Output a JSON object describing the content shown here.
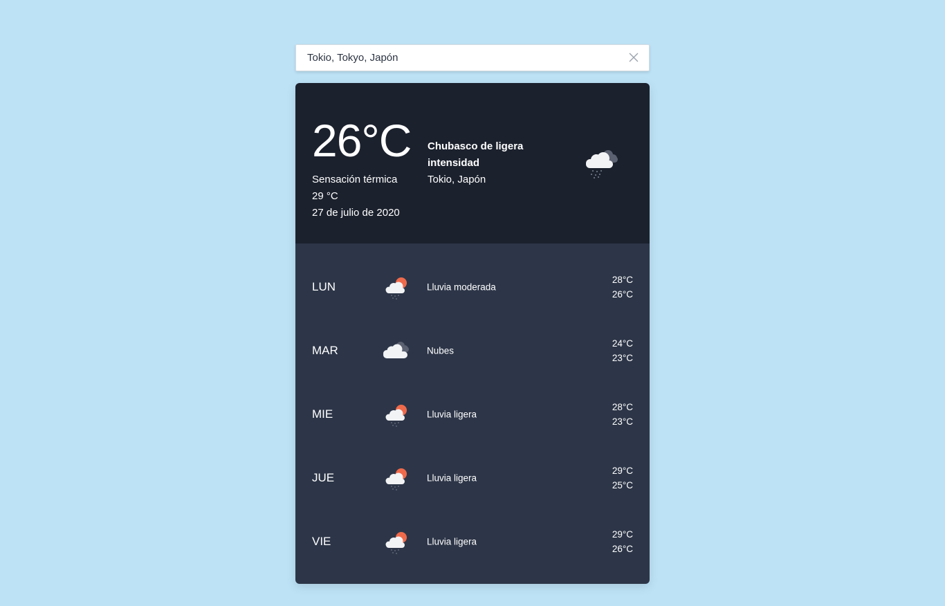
{
  "search": {
    "value": "Tokio, Tokyo, Japón"
  },
  "current": {
    "temperature": "26°C",
    "feels_like_label": "Sensación térmica",
    "feels_like_value": "29 °C",
    "date": "27 de julio de 2020",
    "description": "Chubasco de ligera intensidad",
    "location": "Tokio, Japón",
    "icon": "rain-cloud-icon"
  },
  "forecast": [
    {
      "day": "LUN",
      "icon": "sun-cloud-rain-icon",
      "description": "Lluvia moderada",
      "max": "28°C",
      "min": "26°C"
    },
    {
      "day": "MAR",
      "icon": "cloud-icon",
      "description": "Nubes",
      "max": "24°C",
      "min": "23°C"
    },
    {
      "day": "MIE",
      "icon": "sun-cloud-rain-icon",
      "description": "Lluvia ligera",
      "max": "28°C",
      "min": "23°C"
    },
    {
      "day": "JUE",
      "icon": "sun-cloud-rain-icon",
      "description": "Lluvia ligera",
      "max": "29°C",
      "min": "25°C"
    },
    {
      "day": "VIE",
      "icon": "sun-cloud-rain-icon",
      "description": "Lluvia ligera",
      "max": "29°C",
      "min": "26°C"
    }
  ],
  "colors": {
    "background": "#bde2f6",
    "current_panel": "#1b212d",
    "forecast_panel": "#2d3648",
    "sun": "#ef6a4b"
  }
}
